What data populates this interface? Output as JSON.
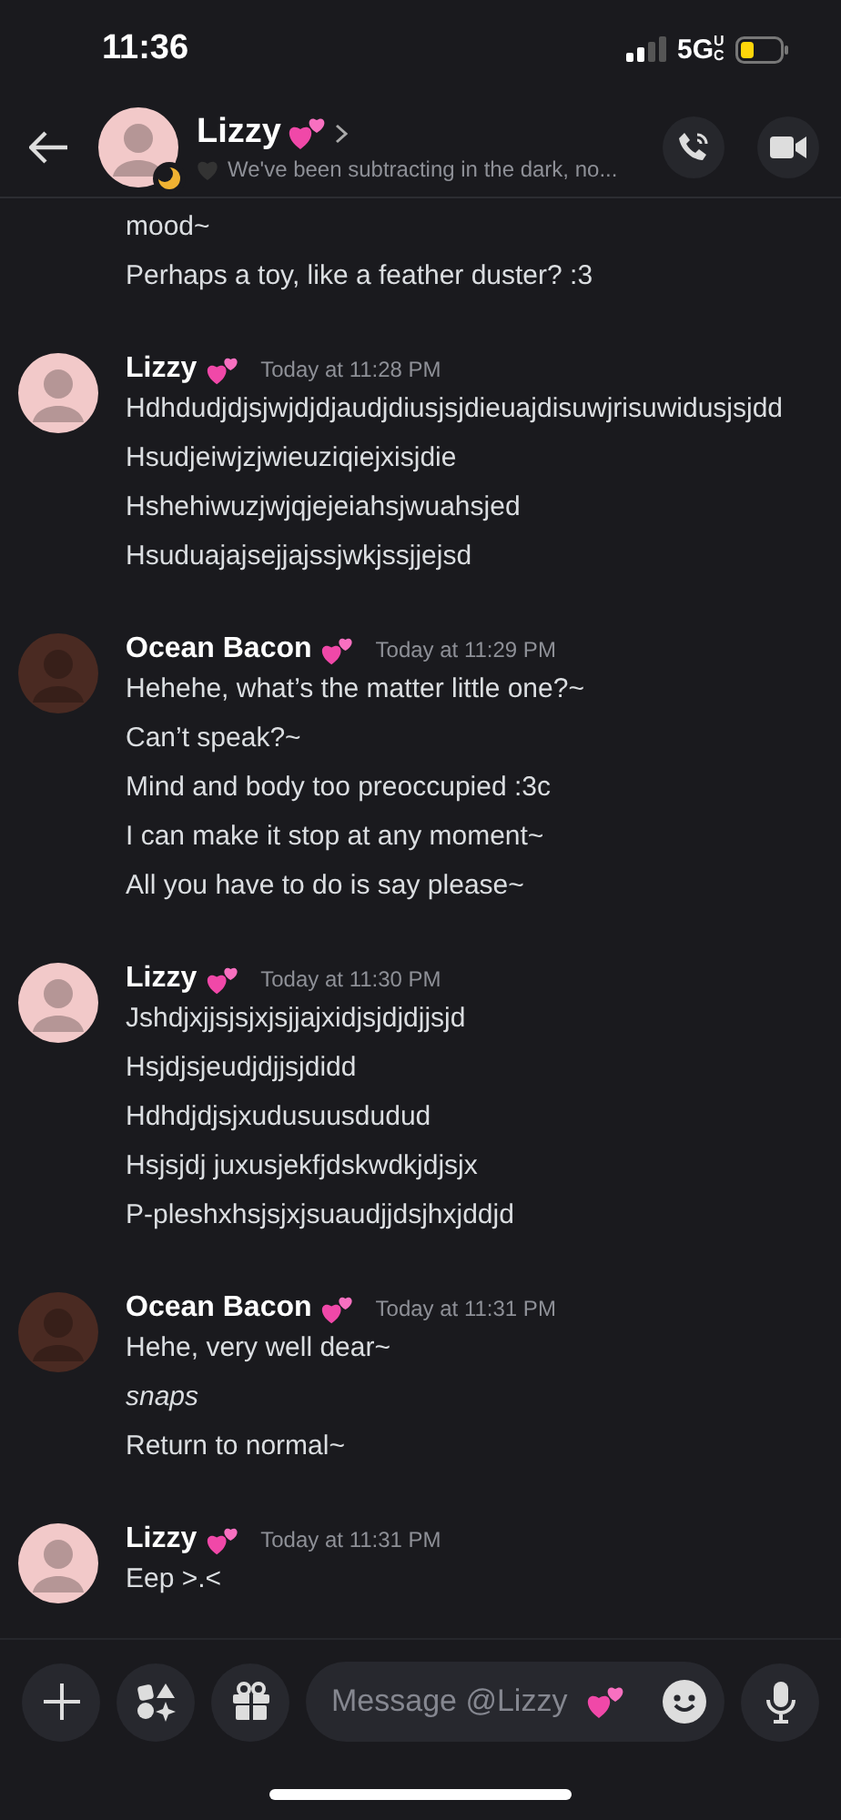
{
  "status_bar": {
    "time": "11:36",
    "network": "5G",
    "network_sup": "UC"
  },
  "header": {
    "name": "Lizzy",
    "idle": true,
    "status": "We've been subtracting in the dark, no..."
  },
  "messages": [
    {
      "kind": "continued",
      "lines": [
        {
          "text": "mood~",
          "italic": false
        },
        {
          "text": "Perhaps a toy, like a feather duster? :3",
          "italic": false
        }
      ]
    },
    {
      "kind": "group",
      "author": "Lizzy",
      "color": "#f2c9c9",
      "time": "Today at 11:28 PM",
      "lines": [
        {
          "text": "Hdhdudjdjsjwjdjdjaudjdiusjsjdieuajdisuwjrisuwidusjsjdd",
          "italic": false
        },
        {
          "text": "Hsudjeiwjzjwieuziqiejxisjdie",
          "italic": false
        },
        {
          "text": "Hshehiwuzjwjqjejeiahsjwuahsjed",
          "italic": false
        },
        {
          "text": "Hsuduajajsejjajssjwkjssjjejsd",
          "italic": false
        }
      ]
    },
    {
      "kind": "group",
      "author": "Ocean Bacon",
      "color": "#4a2a22",
      "time": "Today at 11:29 PM",
      "lines": [
        {
          "text": "Hehehe, what’s the matter little one?~",
          "italic": false
        },
        {
          "text": "Can’t speak?~",
          "italic": false
        },
        {
          "text": "Mind and body too preoccupied :3c",
          "italic": false
        },
        {
          "text": "I can make it stop at any moment~",
          "italic": false
        },
        {
          "text": "All you have to do is say please~",
          "italic": false
        }
      ]
    },
    {
      "kind": "group",
      "author": "Lizzy",
      "color": "#f2c9c9",
      "time": "Today at 11:30 PM",
      "lines": [
        {
          "text": "Jshdjxjjsjsjxjsjjajxidjsjdjdjjsjd",
          "italic": false
        },
        {
          "text": "Hsjdjsjeudjdjjsjdidd",
          "italic": false
        },
        {
          "text": "Hdhdjdjsjxudusuusdudud",
          "italic": false
        },
        {
          "text": "Hsjsjdj juxusjekfjdskwdkjdjsjx",
          "italic": false
        },
        {
          "text": "P-pleshxhsjsjxjsuaudjjdsjhxjddjd",
          "italic": false
        }
      ]
    },
    {
      "kind": "group",
      "author": "Ocean Bacon",
      "color": "#4a2a22",
      "time": "Today at 11:31 PM",
      "lines": [
        {
          "text": "Hehe, very well dear~",
          "italic": false
        },
        {
          "text": "snaps",
          "italic": true
        },
        {
          "text": "Return to normal~",
          "italic": false
        }
      ]
    },
    {
      "kind": "group",
      "author": "Lizzy",
      "color": "#f2c9c9",
      "time": "Today at 11:31 PM",
      "lines": [
        {
          "text": "Eep >.<",
          "italic": false
        }
      ]
    }
  ],
  "composer": {
    "placeholder": "Message @Lizzy"
  }
}
